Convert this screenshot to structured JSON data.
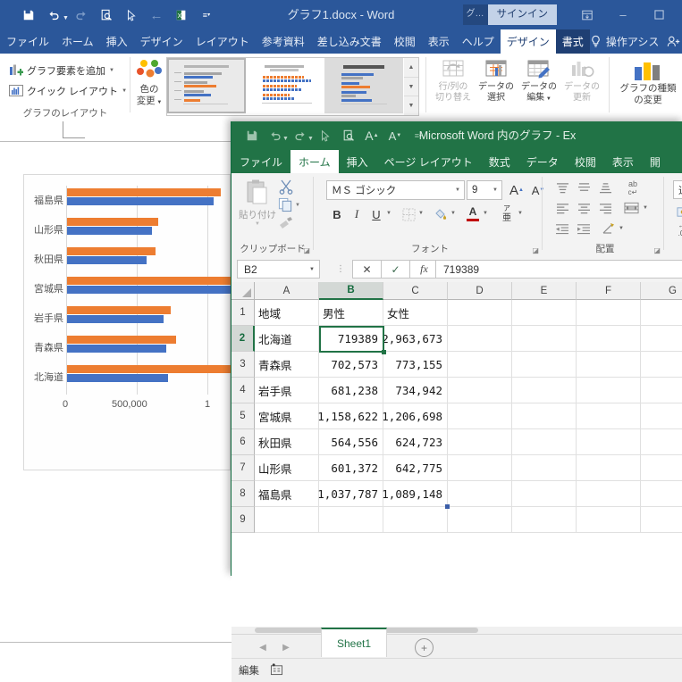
{
  "word": {
    "titlebar": {
      "title": "グラフ1.docx  -  Word",
      "qat": [
        {
          "name": "save-icon",
          "glyph": "💾"
        },
        {
          "name": "undo-icon",
          "glyph": "↶"
        },
        {
          "name": "redo-icon",
          "glyph": "↻"
        },
        {
          "name": "print-preview-icon",
          "glyph": "🗋"
        },
        {
          "name": "pointer-icon",
          "glyph": "↖"
        },
        {
          "name": "back-icon",
          "glyph": "←"
        },
        {
          "name": "excel-object-icon",
          "glyph": "X"
        },
        {
          "name": "customize-qat-icon",
          "glyph": "☰"
        }
      ],
      "graph_chip": "グ…",
      "signin": "サインイン",
      "ribbon_display": "ribbon-display-options-icon",
      "minimize": "–",
      "restore": "❐",
      "close": "✕"
    },
    "tabs": [
      {
        "label": "ファイル",
        "state": "normal"
      },
      {
        "label": "ホーム",
        "state": "normal"
      },
      {
        "label": "挿入",
        "state": "normal"
      },
      {
        "label": "デザイン",
        "state": "normal"
      },
      {
        "label": "レイアウト",
        "state": "normal"
      },
      {
        "label": "参考資料",
        "state": "normal"
      },
      {
        "label": "差し込み文書",
        "state": "normal"
      },
      {
        "label": "校閲",
        "state": "normal"
      },
      {
        "label": "表示",
        "state": "normal"
      },
      {
        "label": "ヘルプ",
        "state": "normal"
      },
      {
        "label": "デザイン",
        "state": "ctxactive"
      },
      {
        "label": "書式",
        "state": "ctx"
      }
    ],
    "tellme": "操作アシス",
    "share_icon": "share-person-icon",
    "ribbon": {
      "group_layout_label": "グラフのレイアウト",
      "add_chart_element": "グラフ要素を追加",
      "quick_layout": "クイック レイアウト",
      "change_colors_line1": "色の",
      "change_colors_line2": "変更",
      "switch_row_col_line1": "行/列の",
      "switch_row_col_line2": "切り替え",
      "select_data_line1": "データの",
      "select_data_line2": "選択",
      "edit_data_line1": "データの",
      "edit_data_line2": "編集",
      "refresh_data_line1": "データの",
      "refresh_data_line2": "更新",
      "change_chart_type_line1": "グラフの種類",
      "change_chart_type_line2": "の変更"
    }
  },
  "excel": {
    "titlebar": {
      "title": "Microsoft Word 内のグラフ  -  Ex",
      "qat": [
        {
          "name": "save-icon",
          "glyph": "💾"
        },
        {
          "name": "undo-icon",
          "glyph": "↶"
        },
        {
          "name": "redo-icon",
          "glyph": "↻"
        },
        {
          "name": "pointer-icon",
          "glyph": "↖"
        },
        {
          "name": "print-preview-icon",
          "glyph": "🗋"
        },
        {
          "name": "increase-font-icon",
          "glyph": "A"
        },
        {
          "name": "decrease-font-icon",
          "glyph": "A"
        },
        {
          "name": "customize-qat-icon",
          "glyph": "☰"
        }
      ]
    },
    "tabs": [
      {
        "label": "ファイル",
        "active": false
      },
      {
        "label": "ホーム",
        "active": true
      },
      {
        "label": "挿入",
        "active": false
      },
      {
        "label": "ページ レイアウト",
        "active": false
      },
      {
        "label": "数式",
        "active": false
      },
      {
        "label": "データ",
        "active": false
      },
      {
        "label": "校閲",
        "active": false
      },
      {
        "label": "表示",
        "active": false
      },
      {
        "label": "開",
        "active": false
      }
    ],
    "ribbon": {
      "clipboard_label": "クリップボード",
      "paste_label": "貼り付け",
      "cut_icon": "scissors-icon",
      "copy_icon": "copy-icon",
      "format_painter_icon": "format-painter-icon",
      "font_label": "フォント",
      "font_name": "ＭＳ ゴシック",
      "font_size": "9",
      "bold": "B",
      "italic": "I",
      "underline": "U",
      "borders_icon": "borders-icon",
      "fill_color_icon": "fill-color-icon",
      "font_color_icon": "font-color-icon",
      "phonetic_line1": "ア",
      "phonetic_line2": "亜",
      "alignment_label": "配置",
      "wrap_text_label": "ab",
      "merge_icon": "merge-cells-icon",
      "orientation_icon": "text-orientation-icon",
      "number_label_partial": "通"
    },
    "namebox": "B2",
    "formula_value": "719389",
    "cancel_icon": "✕",
    "enter_icon": "✓",
    "fx_icon": "fx",
    "columns": [
      "A",
      "B",
      "C",
      "D",
      "E",
      "F",
      "G"
    ],
    "selected_column": "B",
    "selected_row": "2",
    "rows": [
      "1",
      "2",
      "3",
      "4",
      "5",
      "6",
      "7",
      "8",
      "9"
    ],
    "sheet_data": [
      [
        "地域",
        "男性",
        "女性"
      ],
      [
        "北海道",
        "719389",
        "2,963,673"
      ],
      [
        "青森県",
        "702,573",
        "773,155"
      ],
      [
        "岩手県",
        "681,238",
        "734,942"
      ],
      [
        "宮城県",
        "1,158,622",
        "1,206,698"
      ],
      [
        "秋田県",
        "564,556",
        "624,723"
      ],
      [
        "山形県",
        "601,372",
        "642,775"
      ],
      [
        "福島県",
        "1,037,787",
        "1,089,148"
      ],
      [
        "",
        "",
        ""
      ]
    ],
    "sheet_tab": "Sheet1",
    "add_sheet_icon": "+",
    "status_mode": "編集",
    "status_icon": "accessibility-check-icon",
    "nav_prev": "◀",
    "nav_next": "▶"
  },
  "chart_data": {
    "type": "bar",
    "orientation": "horizontal",
    "title": "",
    "categories": [
      "北海道",
      "青森県",
      "岩手県",
      "宮城県",
      "秋田県",
      "山形県",
      "福島県"
    ],
    "series": [
      {
        "name": "男性",
        "color": "#4472c4",
        "values": [
          719389,
          702573,
          681238,
          1158622,
          564556,
          601372,
          1037787
        ]
      },
      {
        "name": "女性",
        "color": "#ed7d31",
        "values": [
          2963673,
          773155,
          734942,
          1206698,
          624723,
          642775,
          1089148
        ]
      }
    ],
    "xlabel": "",
    "ylabel": "",
    "xticks": [
      "0",
      "500,000",
      "1"
    ],
    "xlim": [
      0,
      1250000
    ],
    "grid": true,
    "legend": "none"
  }
}
